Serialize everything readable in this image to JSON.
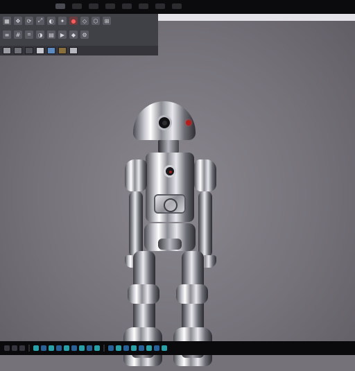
{
  "colors": {
    "background": "#75727a",
    "toolbar": "#404047",
    "accent_red": "#b21d1d"
  },
  "top_strip": {
    "tabs": [
      {
        "name": "tab-1",
        "active": true
      },
      {
        "name": "tab-2",
        "active": false
      },
      {
        "name": "tab-3",
        "active": false
      },
      {
        "name": "tab-4",
        "active": false
      },
      {
        "name": "tab-5",
        "active": false
      },
      {
        "name": "tab-6",
        "active": false
      },
      {
        "name": "tab-7",
        "active": false
      },
      {
        "name": "tab-8",
        "active": false
      }
    ]
  },
  "toolbar": {
    "row1_tools": [
      {
        "icon": "select-icon",
        "glyph": "▦",
        "style": "normal"
      },
      {
        "icon": "move-icon",
        "glyph": "✥",
        "style": "normal"
      },
      {
        "icon": "rotate-icon",
        "glyph": "⟳",
        "style": "normal"
      },
      {
        "icon": "scale-icon",
        "glyph": "⤢",
        "style": "normal"
      },
      {
        "icon": "camera-icon",
        "glyph": "◐",
        "style": "normal"
      },
      {
        "icon": "light-icon",
        "glyph": "✦",
        "style": "normal"
      },
      {
        "icon": "render-icon",
        "glyph": "●",
        "style": "red"
      },
      {
        "icon": "material-icon",
        "glyph": "◇",
        "style": "normal"
      },
      {
        "icon": "mesh-icon",
        "glyph": "⬡",
        "style": "normal"
      },
      {
        "icon": "snap-icon",
        "glyph": "⊞",
        "style": "normal"
      }
    ],
    "row2_tools": [
      {
        "icon": "layers-icon",
        "glyph": "≡",
        "style": "normal"
      },
      {
        "icon": "grid-icon",
        "glyph": "#",
        "style": "normal"
      },
      {
        "icon": "wire-icon",
        "glyph": "⌗",
        "style": "normal"
      },
      {
        "icon": "shade-icon",
        "glyph": "◑",
        "style": "normal"
      },
      {
        "icon": "texture-icon",
        "glyph": "▤",
        "style": "normal"
      },
      {
        "icon": "anim-icon",
        "glyph": "▶",
        "style": "normal"
      },
      {
        "icon": "keyframe-icon",
        "glyph": "◆",
        "style": "normal"
      },
      {
        "icon": "settings-icon",
        "glyph": "⚙",
        "style": "normal"
      }
    ]
  },
  "swatches": [
    "#9c9ca4",
    "#6f6f78",
    "#4e4e56",
    "#c8c8d0",
    "#5b8bc2",
    "#8a6f3b",
    "#b7b7bf"
  ],
  "taskbar": {
    "icons": [
      {
        "name": "taskbar-icon-1",
        "kind": "dim"
      },
      {
        "name": "taskbar-icon-2",
        "kind": "dim"
      },
      {
        "name": "taskbar-icon-3",
        "kind": "dim"
      },
      {
        "name": "taskbar-icon-4",
        "kind": "alt"
      },
      {
        "name": "taskbar-icon-5",
        "kind": "normal"
      },
      {
        "name": "taskbar-icon-6",
        "kind": "alt"
      },
      {
        "name": "taskbar-icon-7",
        "kind": "normal"
      },
      {
        "name": "taskbar-icon-8",
        "kind": "alt"
      },
      {
        "name": "taskbar-icon-9",
        "kind": "normal"
      },
      {
        "name": "taskbar-icon-10",
        "kind": "alt"
      },
      {
        "name": "taskbar-icon-11",
        "kind": "normal"
      },
      {
        "name": "taskbar-icon-12",
        "kind": "alt"
      },
      {
        "name": "taskbar-icon-13",
        "kind": "normal"
      },
      {
        "name": "taskbar-icon-14",
        "kind": "alt"
      },
      {
        "name": "taskbar-icon-15",
        "kind": "normal"
      },
      {
        "name": "taskbar-icon-16",
        "kind": "alt"
      },
      {
        "name": "taskbar-icon-17",
        "kind": "normal"
      },
      {
        "name": "taskbar-icon-18",
        "kind": "alt"
      },
      {
        "name": "taskbar-icon-19",
        "kind": "normal"
      },
      {
        "name": "taskbar-icon-20",
        "kind": "alt"
      }
    ]
  }
}
